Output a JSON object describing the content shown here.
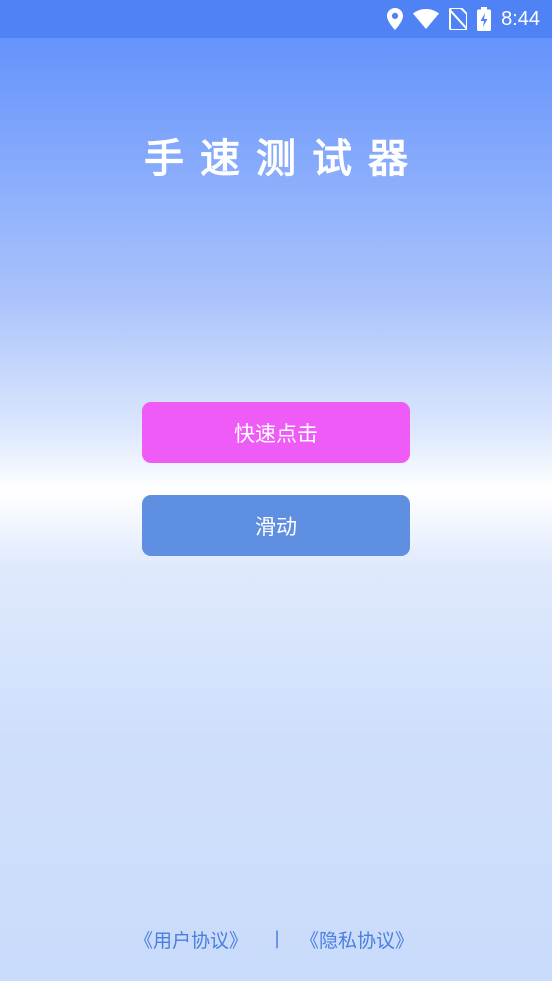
{
  "status_bar": {
    "time": "8:44",
    "icons": [
      "location-icon",
      "wifi-icon",
      "no-sim-icon",
      "battery-charging-icon"
    ]
  },
  "app": {
    "title": "手速测试器"
  },
  "buttons": {
    "quick_click": "快速点击",
    "swipe": "滑动"
  },
  "footer": {
    "user_agreement": "《用户协议》",
    "separator": "|",
    "privacy_agreement": "《隐私协议》"
  },
  "colors": {
    "status_bar": "#4f83f5",
    "quick_click_button": "#ef5bf7",
    "swipe_button": "#5f8fe0",
    "link": "#4a7ee0"
  }
}
